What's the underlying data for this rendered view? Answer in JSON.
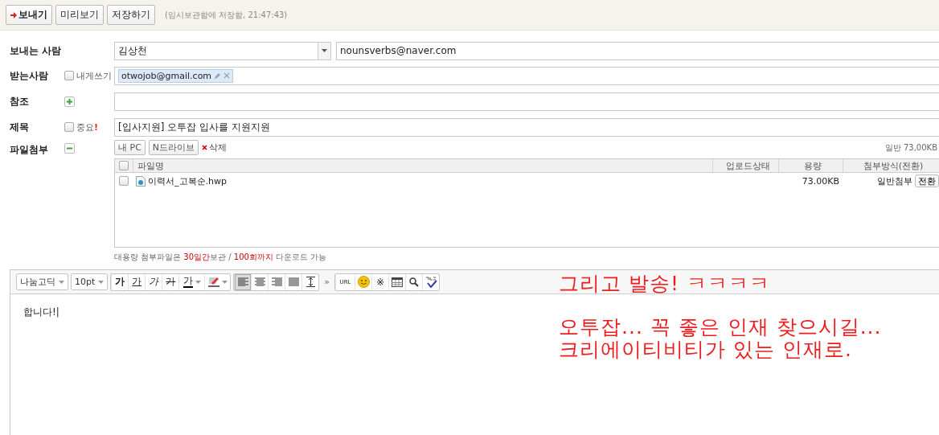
{
  "toolbar": {
    "buttons": [
      {
        "label": "보내기",
        "kind": "send"
      },
      {
        "label": "미리보기",
        "kind": "plain"
      },
      {
        "label": "저장하기",
        "kind": "plain"
      }
    ],
    "save_status": "(임시보관함에 저장함, 21:47:43)"
  },
  "sender": {
    "label": "보내는 사람",
    "name": "김상천",
    "address": "nounsverbs@naver.com"
  },
  "recipient": {
    "label": "받는사람",
    "self_label": "내게쓰기",
    "self_checked": false,
    "chips": [
      "otwojob@gmail.com"
    ]
  },
  "cc": {
    "label": "참조",
    "expanded": false
  },
  "subject": {
    "label": "제목",
    "important_label": "중요",
    "important_mark": "!",
    "important_checked": false,
    "value": "[입사지원] 오투잡 입사를 지원지원"
  },
  "attachment": {
    "label": "파일첨부",
    "expanded": true,
    "buttons": [
      "내 PC",
      "N드라이브"
    ],
    "delete_label": "삭제",
    "summary": "일반 73,00KB",
    "all_checked": false,
    "columns": [
      "파일명",
      "업로드상태",
      "용량",
      "첨부방식(전환)"
    ],
    "files": [
      {
        "name": "이력서_고복순.hwp",
        "checked": false,
        "size": "73.00KB",
        "method": "일반첨부",
        "switch_label": "전환"
      }
    ],
    "note": [
      {
        "text": "대용량 첨부파일은 ",
        "emphasis": false
      },
      {
        "text": "30일간",
        "emphasis": true
      },
      {
        "text": "보관 / ",
        "emphasis": false
      },
      {
        "text": "100회까지",
        "emphasis": true
      },
      {
        "text": " 다운로드 가능",
        "emphasis": false
      }
    ]
  },
  "editor": {
    "font": "나눔고딕",
    "size": "10pt",
    "tool_groups": [
      [
        {
          "kind": "bold",
          "label": "가"
        },
        {
          "kind": "underline",
          "label": "가"
        },
        {
          "kind": "italic",
          "label": "가"
        },
        {
          "kind": "strike",
          "label": "가"
        },
        {
          "kind": "color",
          "label": "가"
        },
        {
          "kind": "highlight"
        }
      ],
      [
        {
          "kind": "align-left",
          "selected": true
        },
        {
          "kind": "align-center",
          "selected": false
        },
        {
          "kind": "align-right",
          "selected": false
        },
        {
          "kind": "justify",
          "selected": false
        },
        {
          "kind": "line-height",
          "selected": false
        }
      ],
      [
        {
          "kind": "url",
          "label": "URL"
        },
        {
          "kind": "emoji"
        },
        {
          "kind": "symbol",
          "label": "※"
        },
        {
          "kind": "table"
        },
        {
          "kind": "find"
        },
        {
          "kind": "spell"
        }
      ]
    ],
    "more_label": "»",
    "body": "합니다!",
    "cursor": "|"
  },
  "annotation": {
    "paragraphs": [
      [
        "그리고 발송! ㅋㅋㅋㅋ"
      ],
      [
        "오투잡... 꼭 좋은 인재 찾으시길...",
        "크리에이티비티가 있는 인재로."
      ]
    ]
  }
}
